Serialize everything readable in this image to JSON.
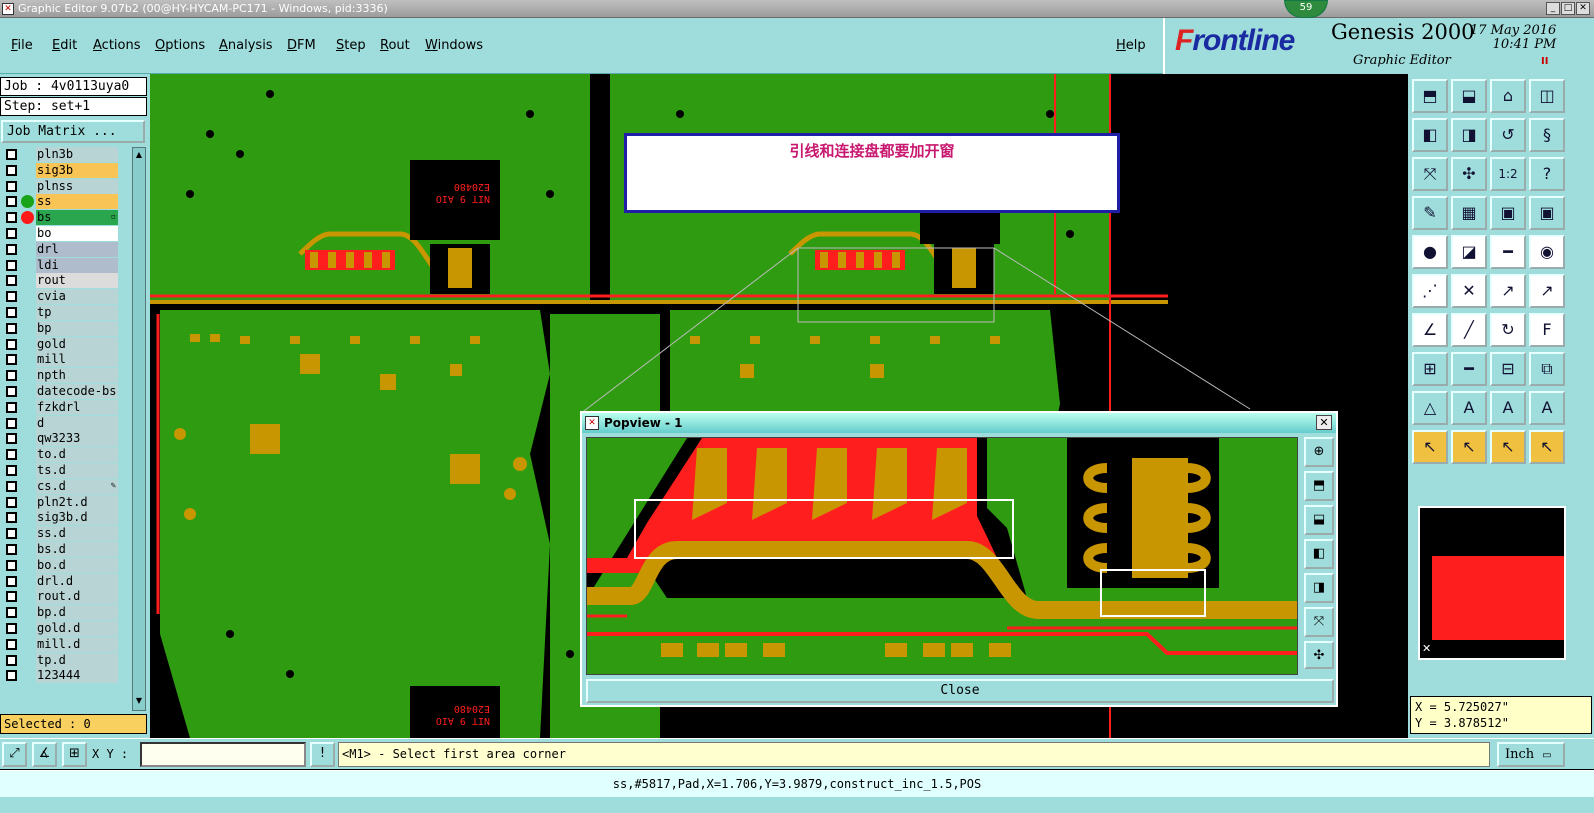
{
  "window": {
    "title": "Graphic Editor 9.07b2 (00@HY-HYCAM-PC171 - Windows, pid:3336)",
    "badge": "59",
    "min": "_",
    "max": "□",
    "close": "✕"
  },
  "menu": [
    "File",
    "Edit",
    "Actions",
    "Options",
    "Analysis",
    "DFM",
    "Step",
    "Rout",
    "Windows",
    "Help"
  ],
  "brand": {
    "logo_f": "F",
    "logo_rest": "rontline",
    "product": "Genesis 2000",
    "module": "Graphic Editor",
    "date": "17 May 2016",
    "time": "10:41 PM",
    "pause": "II"
  },
  "left": {
    "job": "Job : 4v0113uya0",
    "step": "Step: set+1",
    "job_matrix": "Job Matrix ...",
    "selected": "Selected : 0",
    "layers": [
      {
        "name": "pln3b",
        "bg": "#b8d4d4"
      },
      {
        "name": "sig3b",
        "bg": "#f7c455"
      },
      {
        "name": "plnss",
        "bg": "#b8d4d4"
      },
      {
        "name": "ss",
        "bg": "#f7c455",
        "dot": "#19a319"
      },
      {
        "name": "bs",
        "bg": "#2aa64e",
        "dot": "#ff1a1a",
        "marker": "▫"
      },
      {
        "name": "bo",
        "bg": "#ffffff"
      },
      {
        "name": "drl",
        "bg": "#aebccb"
      },
      {
        "name": "ldi",
        "bg": "#aebccb"
      },
      {
        "name": "rout",
        "bg": "#dcdcdc"
      },
      {
        "name": "cvia",
        "bg": "#b8d4d4"
      },
      {
        "name": "tp",
        "bg": "#b8d4d4"
      },
      {
        "name": "bp",
        "bg": "#b8d4d4"
      },
      {
        "name": "gold",
        "bg": "#b8d4d4"
      },
      {
        "name": "mill",
        "bg": "#b8d4d4"
      },
      {
        "name": "npth",
        "bg": "#b8d4d4"
      },
      {
        "name": "datecode-bs",
        "bg": "#b8d4d4"
      },
      {
        "name": "fzkdrl",
        "bg": "#b8d4d4"
      },
      {
        "name": "d",
        "bg": "#b8d4d4"
      },
      {
        "name": "qw3233",
        "bg": "#b8d4d4"
      },
      {
        "name": "to.d",
        "bg": "#b8d4d4"
      },
      {
        "name": "ts.d",
        "bg": "#b8d4d4"
      },
      {
        "name": "cs.d",
        "bg": "#b8d4d4",
        "marker": "✎"
      },
      {
        "name": "pln2t.d",
        "bg": "#b8d4d4"
      },
      {
        "name": "sig3b.d",
        "bg": "#b8d4d4"
      },
      {
        "name": "ss.d",
        "bg": "#b8d4d4"
      },
      {
        "name": "bs.d",
        "bg": "#b8d4d4"
      },
      {
        "name": "bo.d",
        "bg": "#b8d4d4"
      },
      {
        "name": "drl.d",
        "bg": "#b8d4d4"
      },
      {
        "name": "rout.d",
        "bg": "#b8d4d4"
      },
      {
        "name": "bp.d",
        "bg": "#b8d4d4"
      },
      {
        "name": "gold.d",
        "bg": "#b8d4d4"
      },
      {
        "name": "mill.d",
        "bg": "#b8d4d4"
      },
      {
        "name": "tp.d",
        "bg": "#b8d4d4"
      },
      {
        "name": "123444",
        "bg": "#b8d4d4"
      }
    ]
  },
  "canvas": {
    "note": "引线和连接盘都要加开窗",
    "chip_text_1": "E20480",
    "chip_text_2": "NIT 9 AIO",
    "colors": {
      "board": "#2f9b10",
      "copper": "#c89600",
      "mask": "#ff1e1e",
      "bg": "#000000"
    }
  },
  "popview": {
    "title": "Popview - 1",
    "close_label": "Close",
    "x": "✕"
  },
  "right": {
    "tools": [
      "home-in-icon",
      "home-down-icon",
      "house-icon",
      "window-split-icon",
      "pan-left-icon",
      "pan-right-icon",
      "rotate-icon",
      "curve-icon",
      "zoom-fit-icon",
      "zoom-sel-icon",
      "ratio-icon",
      "help-icon",
      "palette-icon",
      "grid-icon",
      "layers-red-icon",
      "layers-blue-icon",
      "pad-add-icon",
      "line-add-icon",
      "ruler-icon",
      "dot-icon",
      "connect-icon",
      "cross-icon",
      "move-icon",
      "slope-icon",
      "angle-icon",
      "diag-icon",
      "undo-icon",
      "flip-icon",
      "add-shape-icon",
      "dash-icon",
      "measure-icon",
      "copy-icon",
      "triangle-icon",
      "triangle-a-icon",
      "a-tool-icon",
      "a-select-icon",
      "pointer-icon",
      "pointer-box-icon",
      "pointer-edit-icon",
      "pointer-multi-icon"
    ],
    "tool_glyphs": [
      "⬒",
      "⬓",
      "⌂",
      "◫",
      "◧",
      "◨",
      "↺",
      "§",
      "⤧",
      "✣",
      "1:2",
      "?",
      "✎",
      "▦",
      "▣",
      "▣",
      "●",
      "◪",
      "━",
      "◉",
      "⋰",
      "✕",
      "↗",
      "↗",
      "∠",
      "╱",
      "↻",
      "F",
      "⊞",
      "━",
      "⊟",
      "⧉",
      "△",
      "A",
      "A",
      "A",
      "↖",
      "↖",
      "↖",
      "↖"
    ],
    "coords_x": "X = 5.725027\"",
    "coords_y": "Y = 3.878512\""
  },
  "bottom": {
    "xy_label": "X Y :",
    "xy_value": "",
    "prompt": "<M1> - Select first area corner",
    "unit": "Inch",
    "status": "ss,#5817,Pad,X=1.706,Y=3.9879,construct_inc_1.5,POS",
    "tool_glyphs": [
      "⤢",
      "∡",
      "⊞",
      "!"
    ]
  }
}
